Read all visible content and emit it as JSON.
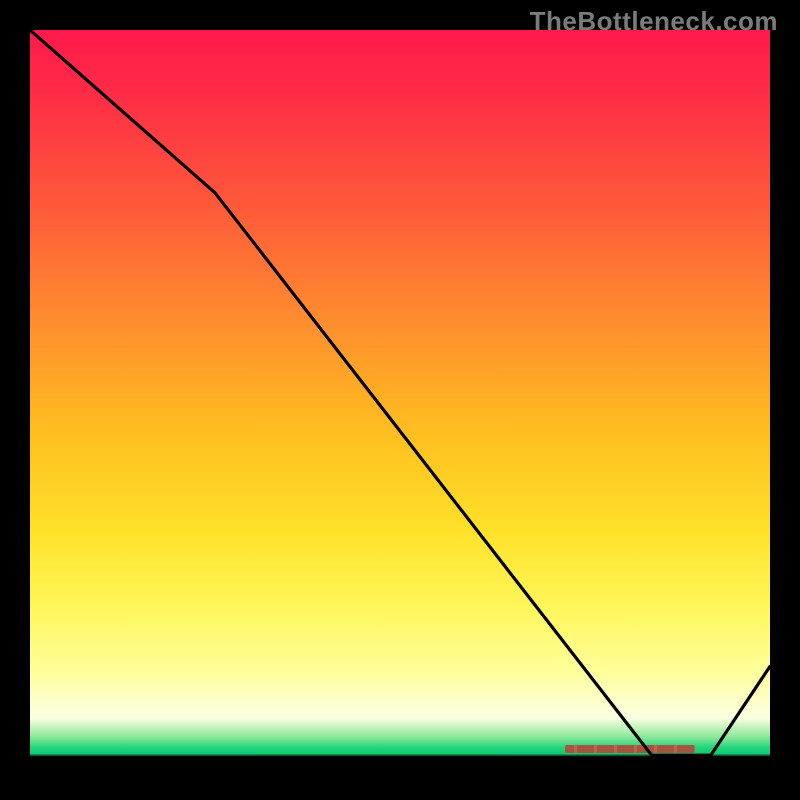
{
  "watermark": "TheBottleneck.com",
  "chart_data": {
    "type": "line",
    "title": "",
    "xlabel": "",
    "ylabel": "",
    "xlim": [
      0,
      100
    ],
    "ylim": [
      0,
      100
    ],
    "grid": false,
    "series": [
      {
        "name": "curve",
        "x": [
          0,
          25,
          84,
          92,
          100
        ],
        "y": [
          100,
          78,
          2,
          2,
          14
        ]
      }
    ],
    "marker": {
      "name": "baseline-segment",
      "x_range": [
        76,
        90
      ],
      "y": 2,
      "color": "#b24a3a"
    },
    "background_gradient": [
      {
        "stop": 0.0,
        "color": "#ff1a4c"
      },
      {
        "stop": 0.4,
        "color": "#ff8f2e"
      },
      {
        "stop": 0.68,
        "color": "#ffe22a"
      },
      {
        "stop": 0.92,
        "color": "#fcffd8"
      },
      {
        "stop": 0.97,
        "color": "#1fd47a"
      },
      {
        "stop": 1.0,
        "color": "#000000"
      }
    ]
  }
}
